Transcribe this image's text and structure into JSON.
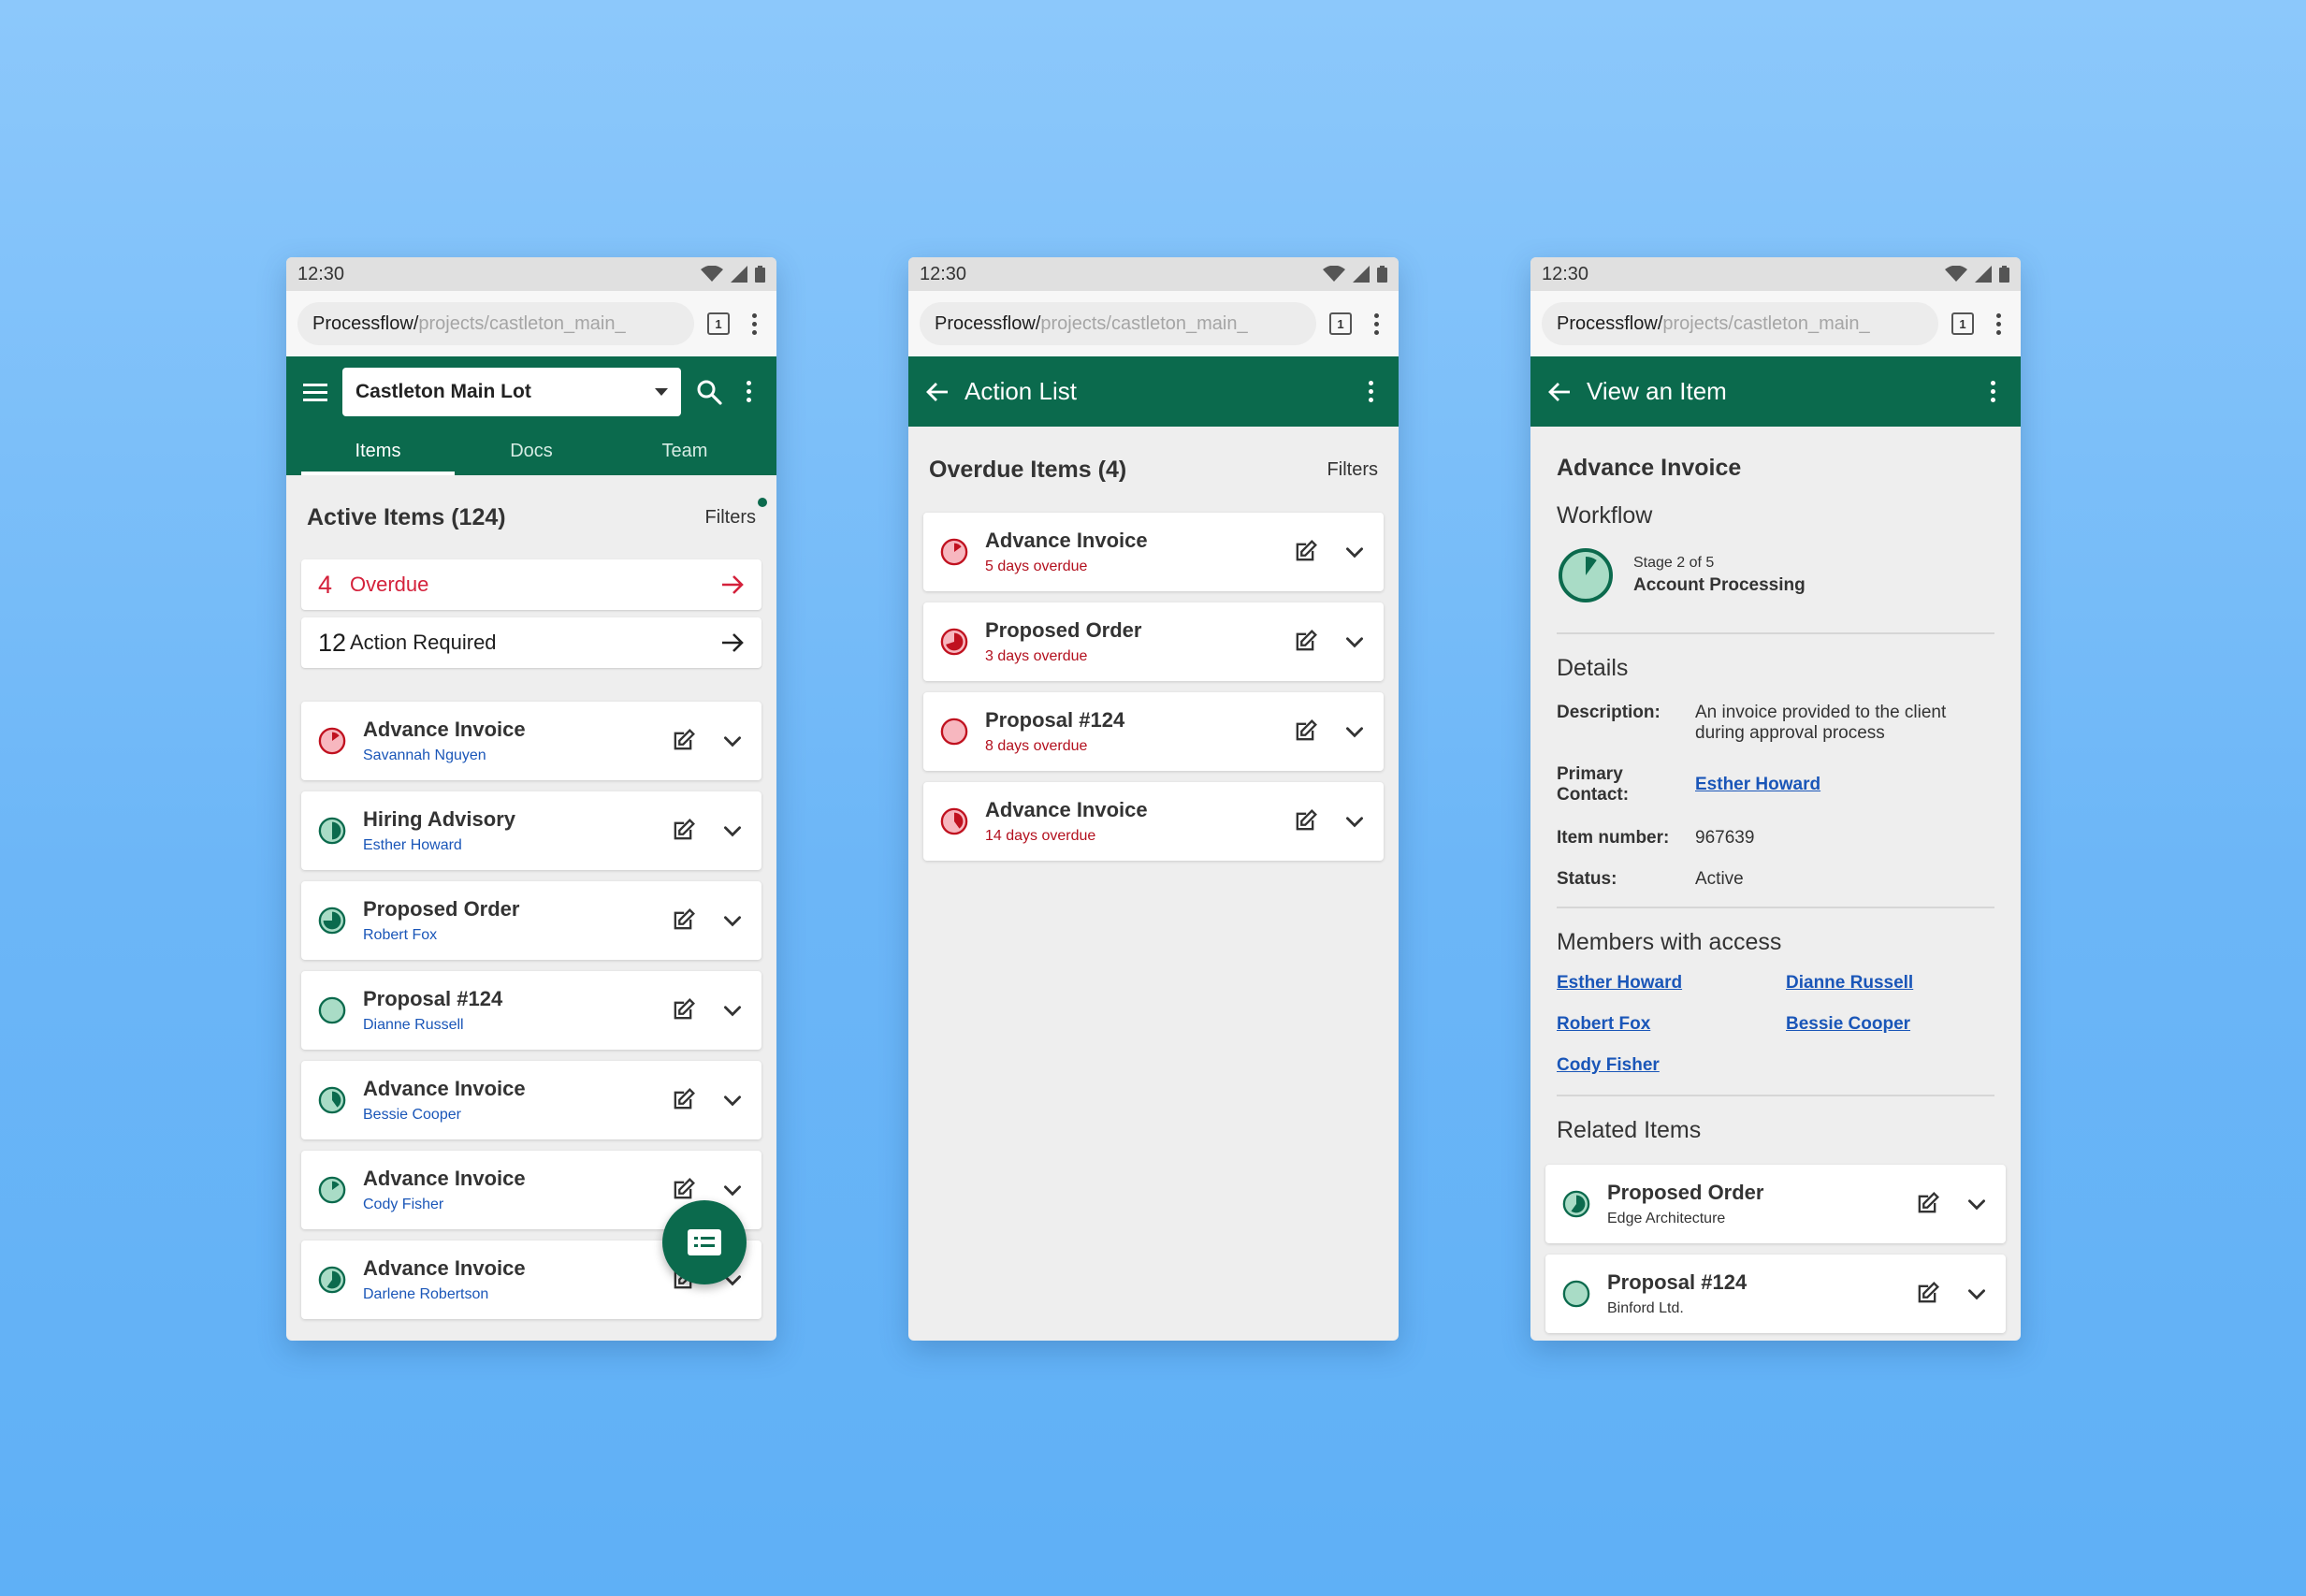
{
  "status": {
    "time": "12:30"
  },
  "browser": {
    "url_host": "Processflow/",
    "url_path": "projects/castleton_main_",
    "tab_count": "1"
  },
  "screen1": {
    "project": "Castleton Main Lot",
    "tabs": [
      "Items",
      "Docs",
      "Team"
    ],
    "section_title": "Active Items (124)",
    "filters_label": "Filters",
    "summaries": [
      {
        "count": "4",
        "label": "Overdue",
        "color": "#d4213b"
      },
      {
        "count": "12",
        "label": "Action Required",
        "color": "#1e1e1e"
      }
    ],
    "items": [
      {
        "title": "Advance Invoice",
        "person": "Savannah Nguyen",
        "progress": 0.15,
        "status": "overdue"
      },
      {
        "title": "Hiring Advisory",
        "person": "Esther Howard",
        "progress": 0.5,
        "status": "active"
      },
      {
        "title": "Proposed Order",
        "person": "Robert Fox",
        "progress": 0.75,
        "status": "active"
      },
      {
        "title": "Proposal #124",
        "person": "Dianne Russell",
        "progress": 0,
        "status": "active"
      },
      {
        "title": "Advance Invoice",
        "person": "Bessie Cooper",
        "progress": 0.4,
        "status": "active"
      },
      {
        "title": "Advance Invoice",
        "person": "Cody Fisher",
        "progress": 0.15,
        "status": "active"
      },
      {
        "title": "Advance Invoice",
        "person": "Darlene Robertson",
        "progress": 0.6,
        "status": "active"
      }
    ],
    "fab_icon": "list-card-icon"
  },
  "screen2": {
    "title": "Action List",
    "section_title": "Overdue Items (4)",
    "filters_label": "Filters",
    "items": [
      {
        "title": "Advance Invoice",
        "note": "5 days overdue",
        "progress": 0.15
      },
      {
        "title": "Proposed Order",
        "note": "3 days overdue",
        "progress": 0.7
      },
      {
        "title": "Proposal #124",
        "note": "8 days overdue",
        "progress": 0
      },
      {
        "title": "Advance Invoice",
        "note": "14 days overdue",
        "progress": 0.4
      }
    ]
  },
  "screen3": {
    "title": "View an Item",
    "item_title": "Advance Invoice",
    "workflow_heading": "Workflow",
    "workflow_stage": "Stage 2 of 5",
    "workflow_name": "Account Processing",
    "workflow_progress": 0.1,
    "details_heading": "Details",
    "description_label": "Description:",
    "description_value": "An invoice provided to the client during approval process",
    "contact_label": "Primary Contact:",
    "contact_value": "Esther Howard",
    "number_label": "Item number:",
    "number_value": "967639",
    "status_label": "Status:",
    "status_value": "Active",
    "members_heading": "Members with access",
    "members": [
      "Esther Howard",
      "Dianne Russell",
      "Robert Fox",
      "Bessie Cooper",
      "Cody Fisher"
    ],
    "related_heading": "Related Items",
    "related": [
      {
        "title": "Proposed Order",
        "org": "Edge Architecture",
        "progress": 0.6
      },
      {
        "title": "Proposal #124",
        "org": "Binford Ltd.",
        "progress": 0
      }
    ]
  },
  "colors": {
    "brand": "#0b6a4d",
    "overdue": "#d4213b",
    "link": "#1a56b8"
  }
}
